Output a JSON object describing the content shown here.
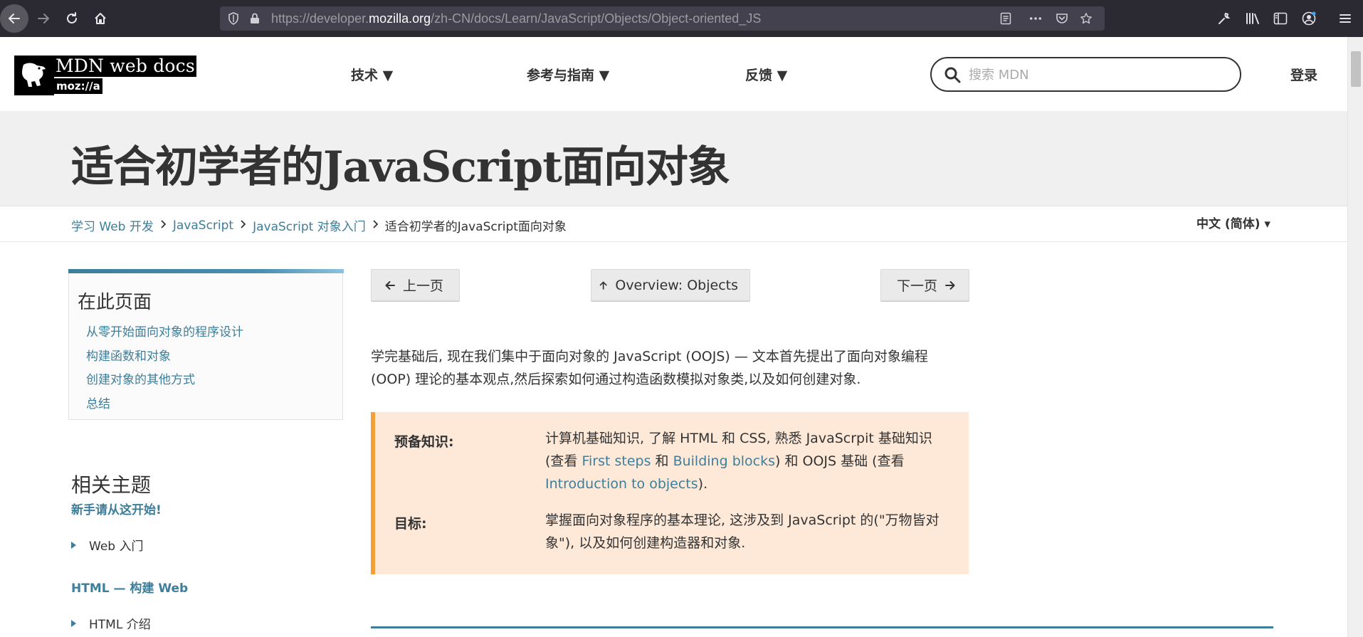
{
  "browser": {
    "url_prefix": "https://developer.",
    "url_host": "mozilla.org",
    "url_path": "/zh-CN/docs/Learn/JavaScript/Objects/Object-oriented_JS"
  },
  "header": {
    "logo_title": "MDN web docs",
    "logo_sub": "moz://a",
    "menu": [
      {
        "label": "技术 ▼"
      },
      {
        "label": "参考与指南 ▼"
      },
      {
        "label": "反馈 ▼"
      }
    ],
    "search_placeholder": "搜索 MDN",
    "login": "登录"
  },
  "page": {
    "title": "适合初学者的JavaScript面向对象",
    "language": "中文 (简体) ▾"
  },
  "breadcrumb": {
    "items": [
      "学习 Web 开发",
      "JavaScript",
      "JavaScript 对象入门"
    ],
    "current": "适合初学者的JavaScript面向对象"
  },
  "toc": {
    "title": "在此页面",
    "items": [
      "从零开始面向对象的程序设计",
      "构建函数和对象",
      "创建对象的其他方式",
      "总结"
    ]
  },
  "related": {
    "title": "相关主题",
    "start": "新手请从这开始!",
    "web_intro": "Web 入门",
    "html_heading": "HTML — 构建 Web",
    "html_intro": "HTML 介绍"
  },
  "pager": {
    "prev": "上一页",
    "overview": "Overview: Objects",
    "next": "下一页"
  },
  "intro": "学完基础后, 现在我们集中于面向对象的 JavaScript (OOJS) — 文本首先提出了面向对象编程(OOP) 理论的基本观点,然后探索如何通过构造函数模拟对象类,以及如何创建对象.",
  "prereq": {
    "label": "预备知识:",
    "text_1": "计算机基础知识, 了解 HTML 和 CSS, 熟悉 JavaScrpit 基础知识 (查看 ",
    "link_1": "First steps",
    "text_2": " 和 ",
    "link_2": "Building blocks",
    "text_3": ") 和 OOJS 基础 (查看 ",
    "link_3": "Introduction to objects",
    "text_4": ").",
    "goal_label": "目标:",
    "goal_text": "掌握面向对象程序的基本理论, 这涉及到 JavaScript  的(\"万物皆对象\"), 以及如何创建构造器和对象."
  }
}
